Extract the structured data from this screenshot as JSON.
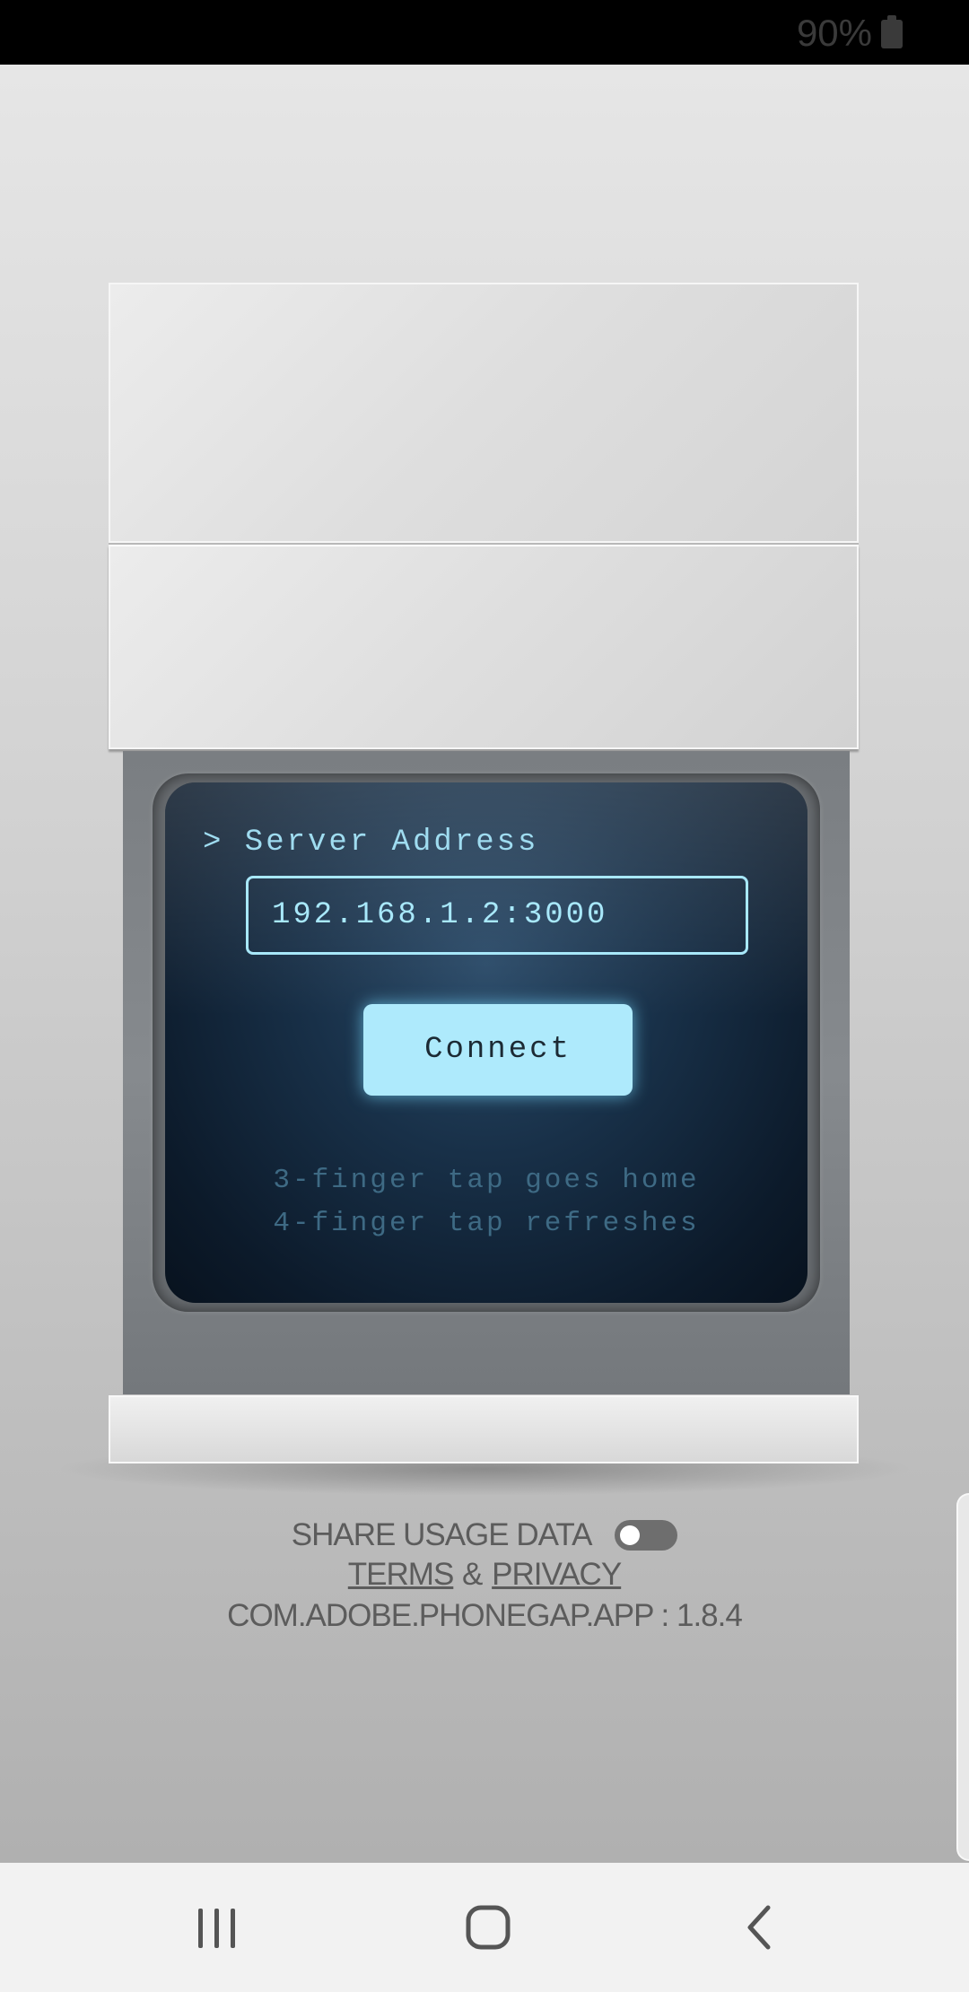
{
  "status_bar": {
    "battery": "90%"
  },
  "screen": {
    "prompt": "> Server Address",
    "server_address": "192.168.1.2:3000",
    "connect_label": "Connect",
    "hint_home": "3-finger tap goes home",
    "hint_refresh": "4-finger tap refreshes"
  },
  "footer": {
    "share_usage_label": "SHARE USAGE DATA",
    "share_usage_enabled": false,
    "terms_label": "TERMS",
    "ampersand": "&",
    "privacy_label": "PRIVACY",
    "version": "COM.ADOBE.PHONEGAP.APP : 1.8.4"
  },
  "nav": {
    "recents_icon": "recents-icon",
    "home_icon": "home-icon",
    "back_icon": "back-icon"
  },
  "colors": {
    "screen_text": "#9fdcf0",
    "button_bg": "#aeeafc",
    "hint_text": "#3e6a84",
    "footer_text": "#5c5c5c"
  }
}
